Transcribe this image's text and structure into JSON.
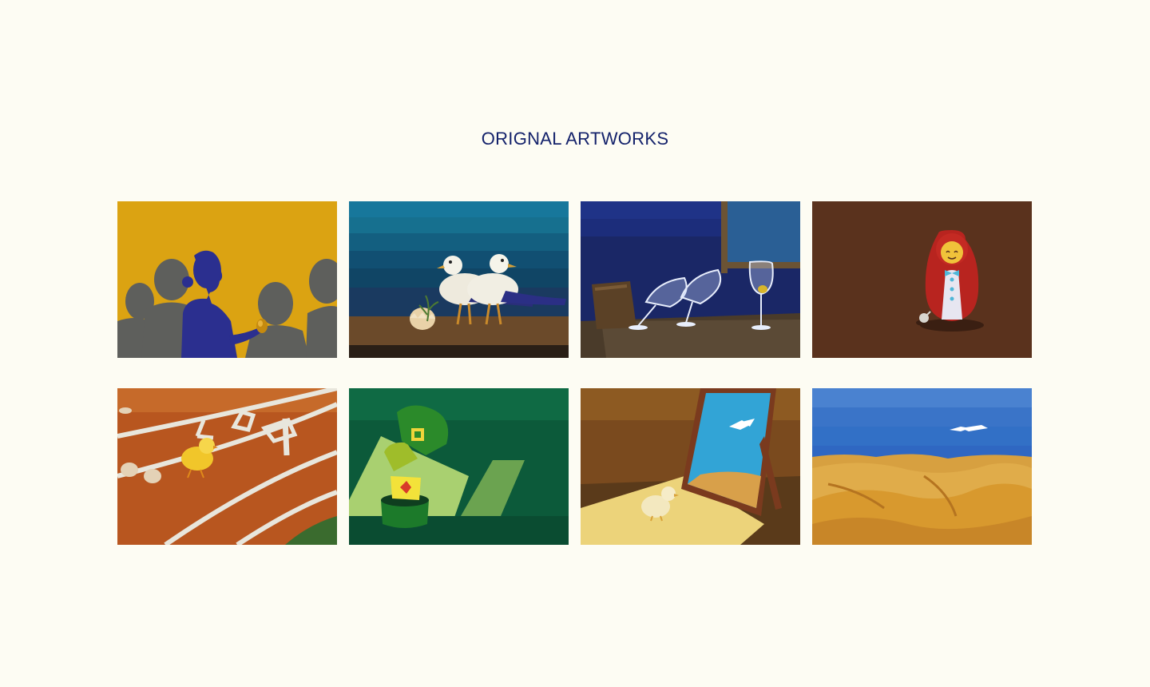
{
  "page": {
    "title": "ORIGNAL ARTWORKS"
  },
  "colors": {
    "background": "#fdfcf3",
    "title": "#14226b"
  },
  "artworks": [
    {
      "icon": "woman-with-golden-egg-artwork"
    },
    {
      "icon": "seagulls-with-egg-artwork"
    },
    {
      "icon": "wine-glasses-artwork"
    },
    {
      "icon": "matryoshka-doll-artwork"
    },
    {
      "icon": "chick-on-running-track-artwork"
    },
    {
      "icon": "stacked-green-cups-artwork"
    },
    {
      "icon": "chick-and-mirror-artwork"
    },
    {
      "icon": "desert-and-seagull-artwork"
    }
  ]
}
